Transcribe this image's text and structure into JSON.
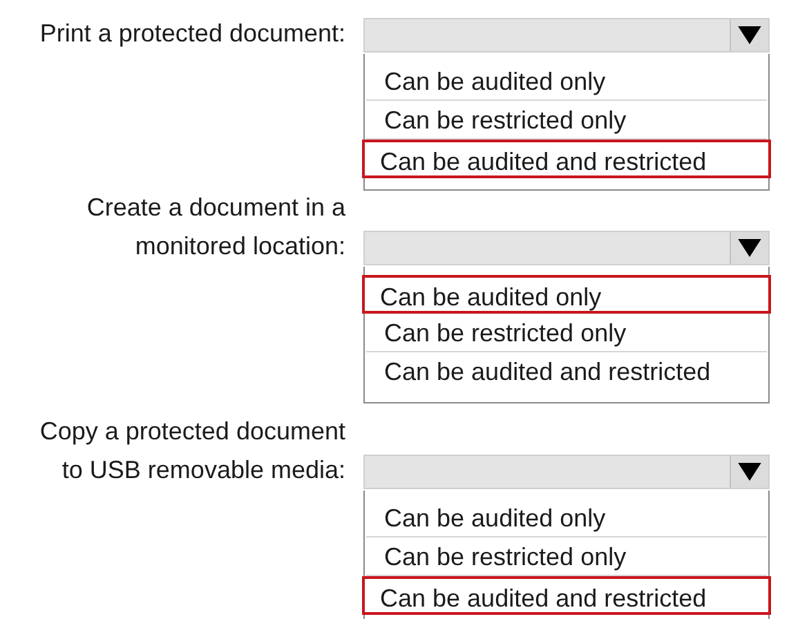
{
  "questions": [
    {
      "label_lines": [
        "Print a protected document:"
      ],
      "options": [
        {
          "label": "Can be audited only",
          "selected": false
        },
        {
          "label": "Can be restricted only",
          "selected": false
        },
        {
          "label": "Can be audited and restricted",
          "selected": true
        }
      ]
    },
    {
      "label_lines": [
        "Create a document in a",
        "monitored location:"
      ],
      "options": [
        {
          "label": "Can be audited only",
          "selected": true
        },
        {
          "label": "Can be restricted only",
          "selected": false
        },
        {
          "label": "Can be audited and restricted",
          "selected": false
        }
      ]
    },
    {
      "label_lines": [
        "Copy a protected document",
        "to USB removable media:"
      ],
      "options": [
        {
          "label": "Can be audited only",
          "selected": false
        },
        {
          "label": "Can be restricted only",
          "selected": false
        },
        {
          "label": "Can be audited and restricted",
          "selected": true
        }
      ]
    }
  ]
}
